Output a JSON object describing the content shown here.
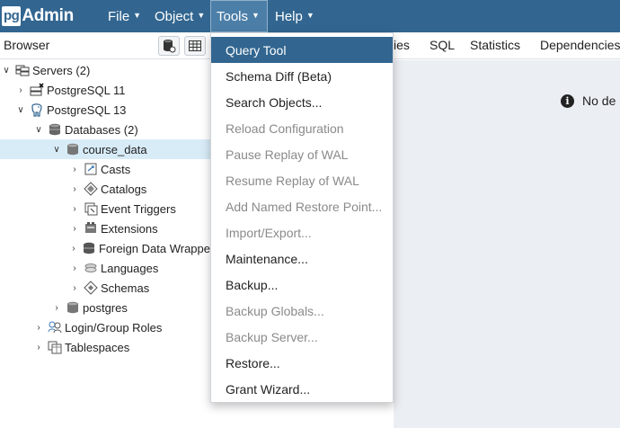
{
  "app": {
    "logo_pg": "pg",
    "logo_admin": "Admin"
  },
  "menubar": [
    {
      "label": "File"
    },
    {
      "label": "Object"
    },
    {
      "label": "Tools"
    },
    {
      "label": "Help"
    }
  ],
  "browser": {
    "title": "Browser"
  },
  "tabs": [
    "ies",
    "SQL",
    "Statistics",
    "Dependencies"
  ],
  "info_message": "No de",
  "tree": [
    {
      "label": "Servers (2)",
      "icon": "servers-icon"
    },
    {
      "label": "PostgreSQL 11",
      "icon": "server-disconnected-icon"
    },
    {
      "label": "PostgreSQL 13",
      "icon": "elephant-icon"
    },
    {
      "label": "Databases (2)",
      "icon": "databases-icon"
    },
    {
      "label": "course_data",
      "icon": "database-icon"
    },
    {
      "label": "Casts",
      "icon": "casts-icon"
    },
    {
      "label": "Catalogs",
      "icon": "catalogs-icon"
    },
    {
      "label": "Event Triggers",
      "icon": "event-triggers-icon"
    },
    {
      "label": "Extensions",
      "icon": "extensions-icon"
    },
    {
      "label": "Foreign Data Wrappe",
      "icon": "foreign-data-wrapper-icon"
    },
    {
      "label": "Languages",
      "icon": "languages-icon"
    },
    {
      "label": "Schemas",
      "icon": "schemas-icon"
    },
    {
      "label": "postgres",
      "icon": "database-icon"
    },
    {
      "label": "Login/Group Roles",
      "icon": "roles-icon"
    },
    {
      "label": "Tablespaces",
      "icon": "tablespaces-icon"
    }
  ],
  "tools_menu": [
    {
      "label": "Query Tool",
      "enabled": true
    },
    {
      "label": "Schema Diff (Beta)",
      "enabled": true
    },
    {
      "label": "Search Objects...",
      "enabled": true
    },
    {
      "label": "Reload Configuration",
      "enabled": false
    },
    {
      "label": "Pause Replay of WAL",
      "enabled": false
    },
    {
      "label": "Resume Replay of WAL",
      "enabled": false
    },
    {
      "label": "Add Named Restore Point...",
      "enabled": false
    },
    {
      "label": "Import/Export...",
      "enabled": false
    },
    {
      "label": "Maintenance...",
      "enabled": true
    },
    {
      "label": "Backup...",
      "enabled": true
    },
    {
      "label": "Backup Globals...",
      "enabled": false
    },
    {
      "label": "Backup Server...",
      "enabled": false
    },
    {
      "label": "Restore...",
      "enabled": true
    },
    {
      "label": "Grant Wizard...",
      "enabled": true
    }
  ],
  "colors": {
    "navbar": "#326690",
    "highlight": "#326690",
    "selected_row": "#d8ecf8",
    "main_bg": "#ebeef3"
  }
}
